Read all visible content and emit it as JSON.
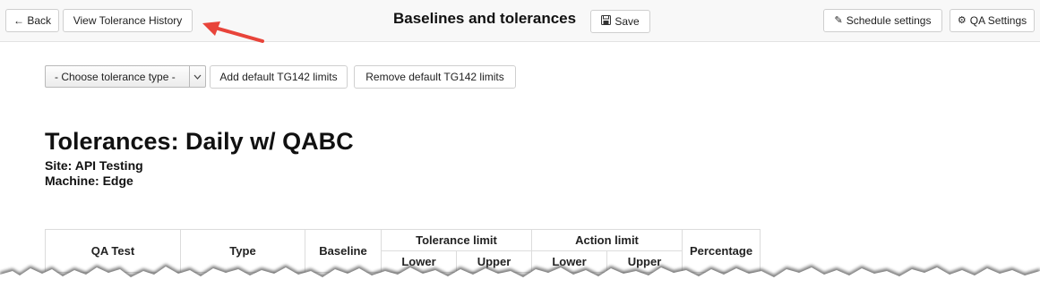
{
  "header": {
    "back_label": "← Back",
    "history_label": "View Tolerance History",
    "title": "Baselines and tolerances",
    "save_label": "Save",
    "schedule_label": "Schedule settings",
    "qa_settings_label": "QA Settings"
  },
  "controls": {
    "tolerance_type_selected": "- Choose tolerance type -",
    "add_default_label": "Add default TG142 limits",
    "remove_default_label": "Remove default TG142 limits"
  },
  "page": {
    "heading": "Tolerances: Daily w/ QABC",
    "site": "Site: API Testing",
    "machine": "Machine: Edge"
  },
  "table": {
    "qa_test": "QA Test",
    "type": "Type",
    "baseline": "Baseline",
    "tolerance_limit": "Tolerance limit",
    "action_limit": "Action limit",
    "percentage": "Percentage",
    "lower": "Lower",
    "upper": "Upper"
  },
  "colors": {
    "annotation_arrow": "#e8443a",
    "topbar_bg": "#f8f8f8",
    "button_border": "#cfcfcf"
  },
  "icons": {
    "save": "floppy-disk-icon",
    "schedule": "pencil-icon",
    "qa_settings": "gear-icon",
    "select_arrow": "chevron-down-icon"
  }
}
